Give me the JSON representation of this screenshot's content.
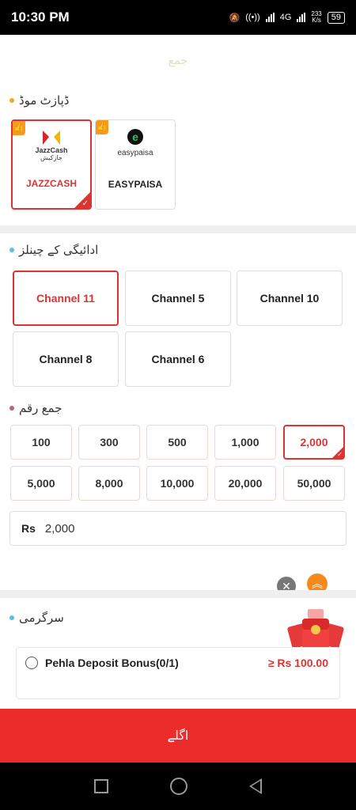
{
  "status_bar": {
    "time": "10:30 PM",
    "network": "4G",
    "speed": "233",
    "speed_unit": "K/s",
    "battery": "59"
  },
  "header": {
    "faded_title": "جمع"
  },
  "deposit_mode": {
    "title": "ڈپازٹ موڈ",
    "methods": [
      {
        "label": "JAZZCASH",
        "logo_text": "JazzCash",
        "logo_sub": "جازکیش",
        "selected": true
      },
      {
        "label": "EASYPAISA",
        "logo_text": "easypaisa",
        "selected": false
      }
    ]
  },
  "channels": {
    "title": "ادائیگی کے چینلز",
    "items": [
      "Channel 11",
      "Channel 5",
      "Channel 10",
      "Channel 8",
      "Channel 6"
    ],
    "selected": "Channel 11"
  },
  "amount": {
    "title": "جمع رقم",
    "options": [
      "100",
      "300",
      "500",
      "1,000",
      "2,000",
      "5,000",
      "8,000",
      "10,000",
      "20,000",
      "50,000"
    ],
    "selected": "2,000",
    "currency": "Rs",
    "value": "2,000"
  },
  "activity": {
    "title": "سرگرمی",
    "bonus_name": "Pehla Deposit Bonus(0/1)",
    "bonus_amount": "≥ Rs 100.00"
  },
  "next_button": "اگلے",
  "colors": {
    "accent": "#ec2b2b",
    "orange": "#f28a1d",
    "dot_yellow": "#f5a623",
    "dot_teal": "#5bc0de",
    "dot_rose": "#c0627a"
  }
}
